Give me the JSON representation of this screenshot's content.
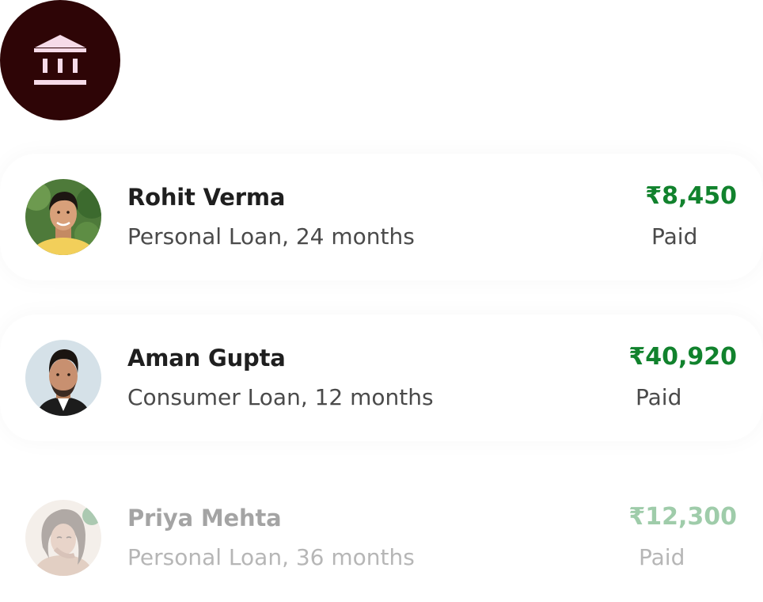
{
  "header": {
    "bank_icon": "bank-icon",
    "badge_color": "#2e0506"
  },
  "accent_color": "#11822d",
  "transactions": [
    {
      "name": "Rohit Verma",
      "loan": "Personal Loan, 24 months",
      "amount": "₹8,450",
      "status": "Paid",
      "avatar": "avatar-rohit"
    },
    {
      "name": "Aman Gupta",
      "loan": "Consumer Loan, 12 months",
      "amount": "₹40,920",
      "status": "Paid",
      "avatar": "avatar-aman"
    },
    {
      "name": "Priya Mehta",
      "loan": "Personal Loan, 36 months",
      "amount": "₹12,300",
      "status": "Paid",
      "avatar": "avatar-priya"
    }
  ]
}
